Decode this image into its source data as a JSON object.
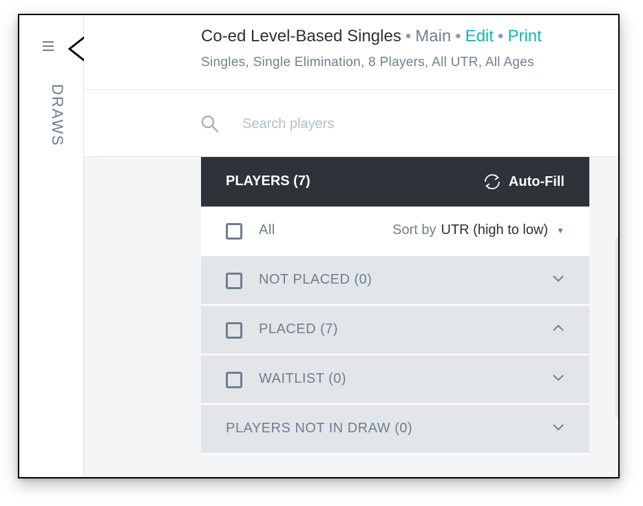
{
  "sidebar": {
    "menu_icon": "hamburger-icon",
    "label": "DRAWS"
  },
  "annotation": {
    "icon": "left-arrow-icon"
  },
  "header": {
    "title": "Co-ed Level-Based Singles",
    "separator": "•",
    "nav_main": "Main",
    "nav_edit": "Edit",
    "nav_print": "Print",
    "subtitle": "Singles, Single Elimination, 8 Players, All UTR, All Ages"
  },
  "search": {
    "icon": "search-icon",
    "placeholder": "Search players"
  },
  "players_panel": {
    "title": "PLAYERS (7)",
    "autofill_label": "Auto-Fill",
    "all_label": "All",
    "sort_prefix": "Sort by",
    "sort_value": "UTR (high to low)",
    "sort_caret": "▼",
    "groups": [
      {
        "label": "NOT PLACED (0)",
        "expanded": false,
        "has_checkbox": true
      },
      {
        "label": "PLACED (7)",
        "expanded": true,
        "has_checkbox": true
      },
      {
        "label": "WAITLIST (0)",
        "expanded": false,
        "has_checkbox": true
      },
      {
        "label": "PLAYERS NOT IN DRAW (0)",
        "expanded": false,
        "has_checkbox": false
      }
    ]
  },
  "colors": {
    "accent": "#0fb8b0",
    "panel_header": "#2d3338",
    "muted_text": "#6d7f8e",
    "group_bg": "#e2e6e9"
  }
}
